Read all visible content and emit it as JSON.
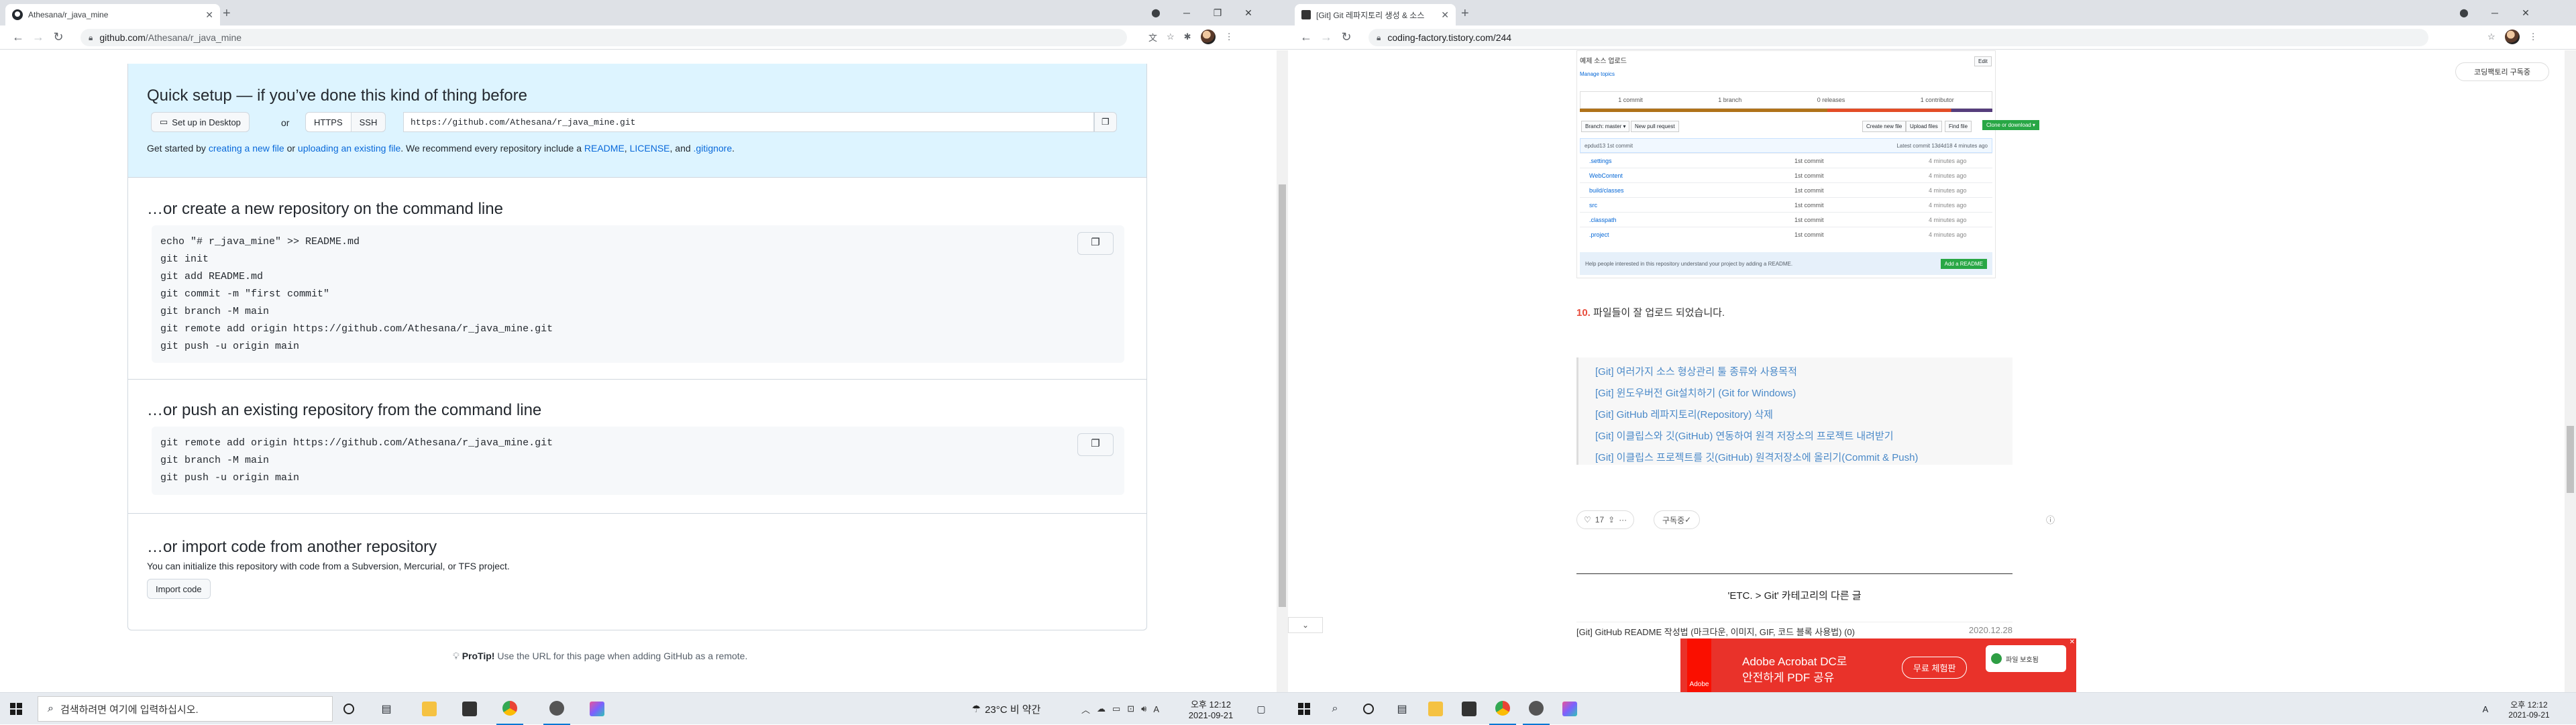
{
  "left_window": {
    "tab_title": "Athesana/r_java_mine",
    "address_host": "github.com",
    "address_path": "/Athesana/r_java_mine",
    "quick_setup": {
      "title": "Quick setup — if you’ve done this kind of thing before",
      "desktop_button": "Set up in Desktop",
      "or": "or",
      "https": "HTTPS",
      "ssh": "SSH",
      "url": "https://github.com/Athesana/r_java_mine.git",
      "started_prefix": "Get started by",
      "new_file": "creating a new file",
      "or2": "or",
      "upload": "uploading an existing file",
      "recommend": ". We recommend every repository include a",
      "readme": "README",
      "license": "LICENSE",
      "and": ", and",
      "gitignore": ".gitignore"
    },
    "section_new": {
      "title": "…or create a new repository on the command line",
      "lines": [
        "echo \"# r_java_mine\" >> README.md",
        "git init",
        "git add README.md",
        "git commit -m \"first commit\"",
        "git branch -M main",
        "git remote add origin https://github.com/Athesana/r_java_mine.git",
        "git push -u origin main"
      ]
    },
    "section_push": {
      "title": "…or push an existing repository from the command line",
      "lines": [
        "git remote add origin https://github.com/Athesana/r_java_mine.git",
        "git branch -M main",
        "git push -u origin main"
      ]
    },
    "section_import": {
      "title": "…or import code from another repository",
      "desc": "You can initialize this repository with code from a Subversion, Mercurial, or TFS project.",
      "button": "Import code"
    },
    "protip_label": "ProTip!",
    "protip_text": "Use the URL for this page when adding GitHub as a remote."
  },
  "right_window": {
    "tab_title": "[Git] Git 레파지토리 생성 & 소스",
    "address": "coding-factory.tistory.com/244",
    "floating_button": "코딩팩토리 구독중",
    "screenshot": {
      "upload_label": "예제 소스 업로드",
      "manage_topics": "Manage topics",
      "edit": "Edit",
      "stats": [
        "1 commit",
        "1 branch",
        "0 releases",
        "1 contributor"
      ],
      "branch": "Branch: master ▾",
      "new_pr": "New pull request",
      "create_file": "Create new file",
      "upload_files": "Upload files",
      "find_file": "Find file",
      "clone": "Clone or download ▾",
      "commit_user": "epdud13 1st commit",
      "latest": "Latest commit 13d4d18 4 minutes ago",
      "files": [
        {
          "name": ".settings",
          "msg": "1st commit",
          "time": "4 minutes ago"
        },
        {
          "name": "WebContent",
          "msg": "1st commit",
          "time": "4 minutes ago"
        },
        {
          "name": "build/classes",
          "msg": "1st commit",
          "time": "4 minutes ago"
        },
        {
          "name": "src",
          "msg": "1st commit",
          "time": "4 minutes ago"
        },
        {
          "name": ".classpath",
          "msg": "1st commit",
          "time": "4 minutes ago"
        },
        {
          "name": ".project",
          "msg": "1st commit",
          "time": "4 minutes ago"
        }
      ],
      "help_text": "Help people interested in this repository understand your project by adding a README.",
      "add_readme": "Add a README"
    },
    "step_number": "10.",
    "step_text": "파일들이 잘 업로드 되었습니다.",
    "related": [
      "[Git] 여러가지 소스 형상관리 툴 종류와 사용목적",
      "[Git] 윈도우버전 Git설치하기 (Git for Windows)",
      "[Git] GitHub 레파지토리(Repository) 삭제",
      "[Git] 이클립스와 깃(GitHub) 연동하여 원격 저장소의 프로젝트 내려받기",
      "[Git] 이클립스 프로젝트를 깃(GitHub) 원격저장소에 올리기(Commit & Push)"
    ],
    "like_count": "17",
    "subscribe": "구독중",
    "category_heading": "'ETC. > Git' 카테고리의 다른 글",
    "next_post": "[Git] GitHub README 작성법 (마크다운, 이미지, GIF, 코드 블록 사용법)  (0)",
    "next_date": "2020.12.28",
    "ad": {
      "title": "Adobe Acrobat DC로",
      "subtitle": "안전하게 PDF 공유",
      "brand": "Adobe",
      "cta": "무료 체험판",
      "badge": "파일 보호됨"
    }
  },
  "taskbar": {
    "search_placeholder": "검색하려면 여기에 입력하십시오.",
    "weather": "23°C  비 약간",
    "time": "오후 12:12",
    "date": "2021-09-21",
    "time2": "오후 12:12",
    "date2": "2021-09-21",
    "ime": "A",
    "ime2": "A"
  }
}
